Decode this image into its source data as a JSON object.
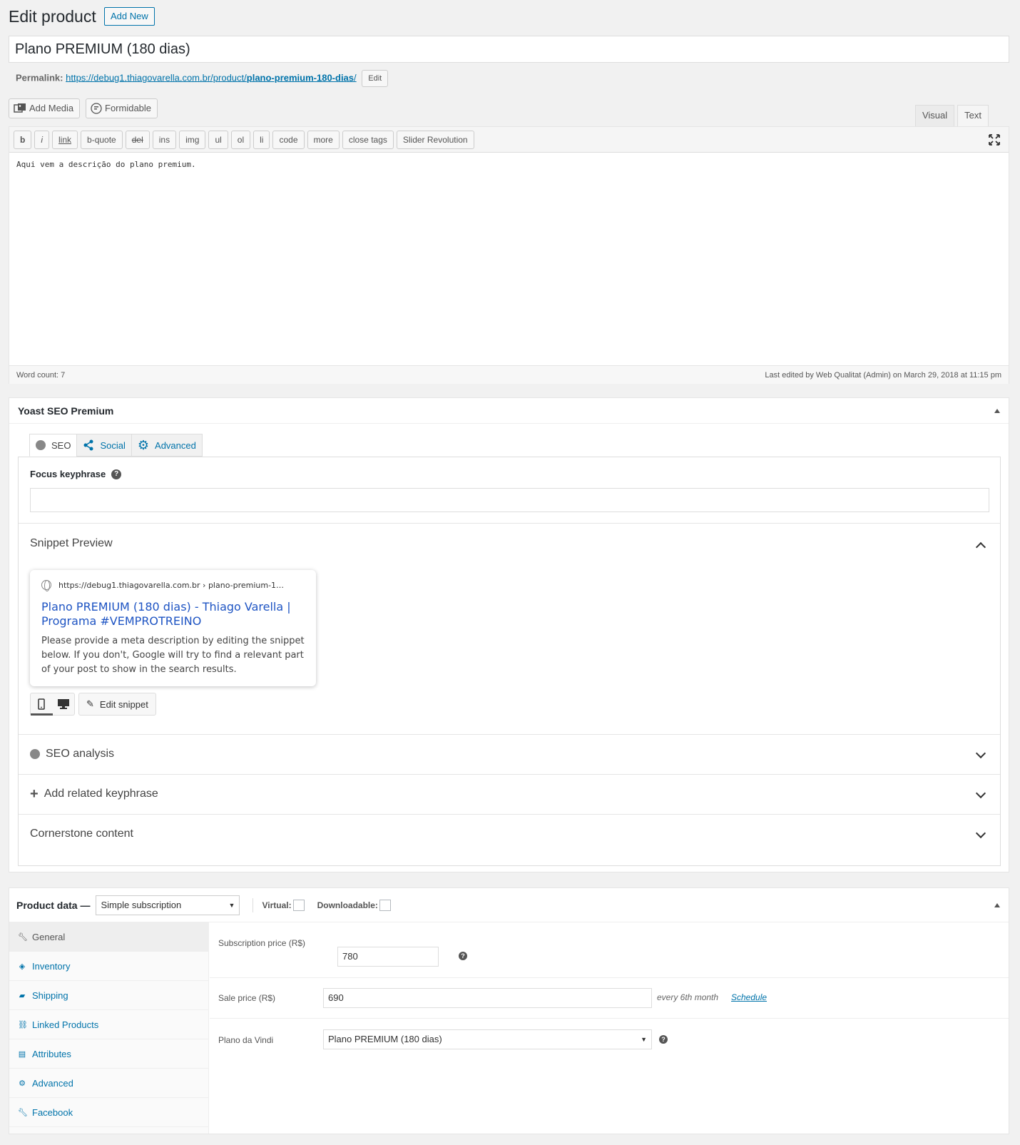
{
  "header": {
    "title": "Edit product",
    "add_new": "Add New"
  },
  "post": {
    "title": "Plano PREMIUM (180 dias)",
    "permalink_label": "Permalink:",
    "permalink_base": "https://debug1.thiagovarella.com.br/product/",
    "permalink_slug": "plano-premium-180-dias",
    "permalink_tail": "/",
    "permalink_edit": "Edit"
  },
  "editor": {
    "add_media": "Add Media",
    "formidable": "Formidable",
    "tab_visual": "Visual",
    "tab_text": "Text",
    "quicktags": [
      "b",
      "i",
      "link",
      "b-quote",
      "del",
      "ins",
      "img",
      "ul",
      "ol",
      "li",
      "code",
      "more",
      "close tags",
      "Slider Revolution"
    ],
    "content": "Aqui vem a descrição do plano premium.",
    "word_count": "Word count: 7",
    "last_edited": "Last edited by Web Qualitat (Admin) on March 29, 2018 at 11:15 pm"
  },
  "yoast": {
    "title": "Yoast SEO Premium",
    "tabs": {
      "seo": "SEO",
      "social": "Social",
      "advanced": "Advanced"
    },
    "focus_label": "Focus keyphrase",
    "focus_value": "",
    "snippet_title": "Snippet Preview",
    "snippet": {
      "url": "https://debug1.thiagovarella.com.br › plano-premium-1…",
      "title": "Plano PREMIUM (180 dias) - Thiago Varella | Programa #VEMPROTREINO",
      "description": "Please provide a meta description by editing the snippet below. If you don't, Google will try to find a relevant part of your post to show in the search results."
    },
    "edit_snippet": "Edit snippet",
    "seo_analysis": "SEO analysis",
    "related": "Add related keyphrase",
    "cornerstone": "Cornerstone content"
  },
  "product_data": {
    "label": "Product data —",
    "type": "Simple subscription",
    "virtual": "Virtual:",
    "downloadable": "Downloadable:",
    "tabs": [
      "General",
      "Inventory",
      "Shipping",
      "Linked Products",
      "Attributes",
      "Advanced",
      "Facebook"
    ],
    "subscription_label": "Subscription price (R$)",
    "subscription_value": "780",
    "sale_label": "Sale price (R$)",
    "sale_value": "690",
    "sale_period": "every 6th month",
    "schedule": "Schedule",
    "vindi_label": "Plano da Vindi",
    "vindi_value": "Plano PREMIUM (180 dias)"
  }
}
